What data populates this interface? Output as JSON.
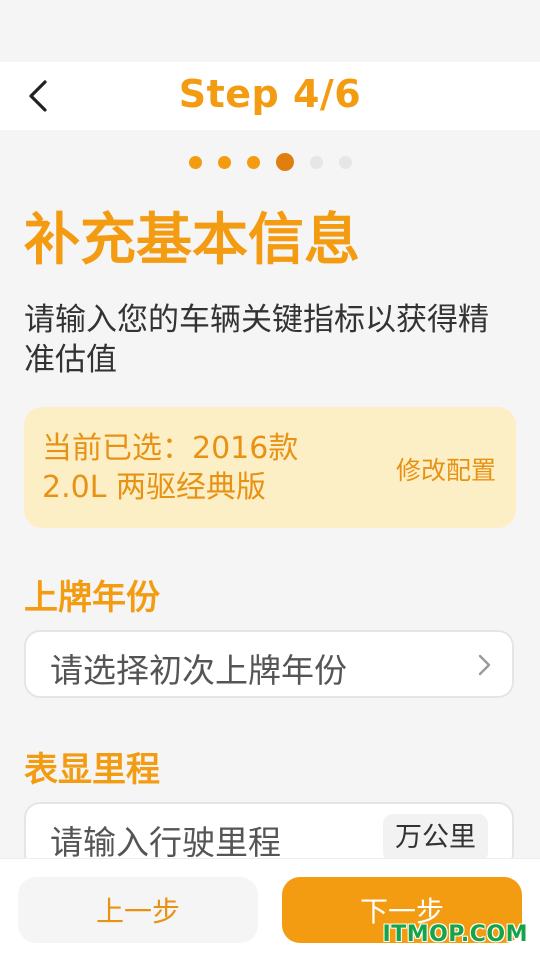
{
  "header": {
    "step_title": "Step 4/6",
    "back_icon": "chevron-left-icon"
  },
  "progress": {
    "total_steps": 6,
    "current_step": 4
  },
  "page": {
    "title": "补充基本信息",
    "subtitle": "请输入您的车辆关键指标以获得精准估值"
  },
  "selection": {
    "text_line1": "当前已选：2016款",
    "text_line2": "2.0L 两驱经典版",
    "modify_label": "修改配置"
  },
  "registration_year": {
    "label": "上牌年份",
    "placeholder": "请选择初次上牌年份",
    "icon": "chevron-right-icon"
  },
  "mileage": {
    "label": "表显里程",
    "placeholder": "请输入行驶里程",
    "unit": "万公里"
  },
  "footer": {
    "prev_label": "上一步",
    "next_label": "下一步"
  },
  "watermark": "ITMOP.COM",
  "colors": {
    "accent": "#f39c12",
    "accent_dark": "#e07f10",
    "card_bg": "#fdefc5",
    "watermark": "#16a34a"
  }
}
